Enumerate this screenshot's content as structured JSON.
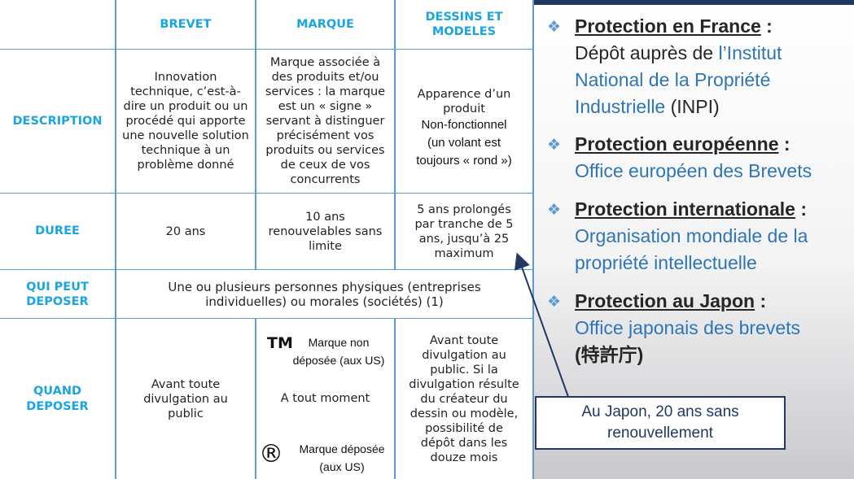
{
  "table": {
    "headers": {
      "brevet": "BREVET",
      "marque": "MARQUE",
      "dessins_line1": "DESSINS ET",
      "dessins_line2": "MODELES"
    },
    "rows": {
      "description": {
        "label": "DESCRIPTION",
        "brevet": [
          "Innovation",
          "technique, c’est-à-",
          "dire un produit ou un",
          "procédé qui apporte",
          "une nouvelle solution",
          "technique à un",
          "problème donné"
        ],
        "marque": [
          "Marque associée à",
          "des produits et/ou",
          "services : la marque",
          "est un « signe »",
          "servant à distinguer",
          "précisément vos",
          "produits ou services",
          "de ceux de vos",
          "concurrents"
        ],
        "dessins": [
          "Apparence d’un",
          "produit"
        ],
        "dessins_extra": [
          "Non-fonctionnel",
          "(un volant est",
          "toujours « rond »)"
        ]
      },
      "duree": {
        "label": "DUREE",
        "brevet": "20 ans",
        "marque": [
          "10 ans",
          "renouvelables sans",
          "limite"
        ],
        "dessins": [
          "5 ans prolongés",
          "par tranche de 5",
          "ans, jusqu’à 25",
          "maximum"
        ]
      },
      "qui_peut_deposer": {
        "label_line1": "QUI PEUT",
        "label_line2": "DEPOSER",
        "content_line1": "Une ou plusieurs personnes physiques (entreprises",
        "content_line2": "individuelles) ou morales (sociétés) (1)"
      },
      "quand_deposer": {
        "label_line1": "QUAND",
        "label_line2": "DEPOSER",
        "brevet": [
          "Avant toute",
          "divulgation au",
          "public"
        ],
        "marque_tm_symbol": "TM",
        "marque_tm_text": [
          "Marque non",
          "déposée (aux US)"
        ],
        "marque_main": "A tout moment",
        "marque_r_symbol": "®",
        "marque_r_text": [
          "Marque déposée",
          "(aux US)"
        ],
        "dessins": [
          "Avant toute",
          "divulgation au",
          "public. Si la",
          "divulgation résulte",
          "du créateur du",
          "dessin ou modèle,",
          "possibilité de",
          "dépôt dans les",
          "douze mois"
        ]
      }
    }
  },
  "panel": {
    "bullet_symbol": "❖",
    "items": [
      {
        "title": "Protection en France",
        "sep": " :",
        "body_dark": "Dépôt auprès de ",
        "body_link": "l’Institut National de la Propriété Industrielle",
        "body_tail": " (INPI)"
      },
      {
        "title": "Protection européenne",
        "sep": " :",
        "body": "Office européen des Brevets"
      },
      {
        "title": "Protection internationale",
        "sep": " :",
        "body": "Organisation mondiale de la propriété intellectuelle"
      },
      {
        "title": "Protection au Japon",
        "sep": " :",
        "body": "Office japonais des brevets",
        "body_dark": "(特許庁)"
      }
    ]
  },
  "callout": {
    "line1": "Au Japon, 20 ans sans",
    "line2": "renouvellement"
  },
  "colors": {
    "accent": "#1aa5e0",
    "grid": "#5b9bd5",
    "navy": "#1f3864",
    "link": "#2e75b6"
  }
}
